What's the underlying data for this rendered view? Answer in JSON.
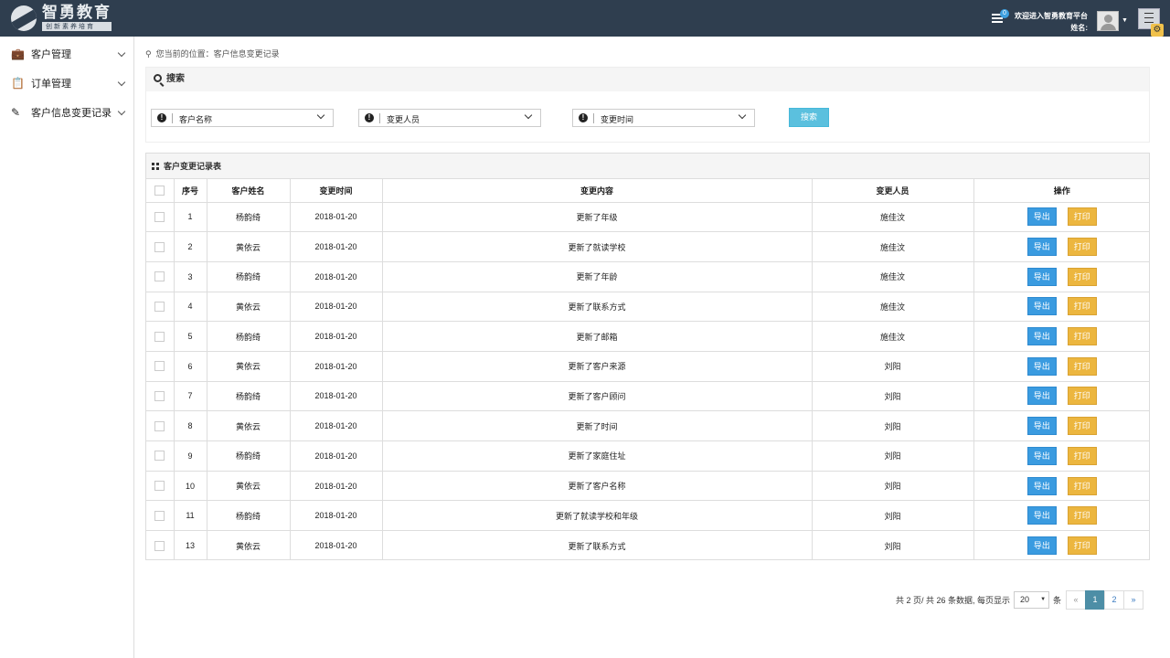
{
  "header": {
    "logo_title": "智勇教育",
    "logo_subtitle": "创新素养培育",
    "message_count": "0",
    "welcome": "欢迎进入智勇教育平台",
    "user_label": "姓名:"
  },
  "sidebar": {
    "items": [
      {
        "label": "客户管理",
        "icon": "briefcase-icon"
      },
      {
        "label": "订单管理",
        "icon": "clipboard-icon"
      },
      {
        "label": "客户信息变更记录",
        "icon": "edit-icon"
      }
    ]
  },
  "breadcrumb": "您当前的位置：客户信息变更记录",
  "search": {
    "title": "搜索",
    "fields": [
      "客户名称",
      "变更人员",
      "变更时间"
    ],
    "button": "搜索"
  },
  "table": {
    "title": "客户变更记录表",
    "columns": [
      "序号",
      "客户姓名",
      "变更时间",
      "变更内容",
      "变更人员",
      "操作"
    ],
    "export_label": "导出",
    "print_label": "打印",
    "rows": [
      {
        "no": "1",
        "name": "杨韵绮",
        "date": "2018-01-20",
        "content": "更新了年级",
        "operator": "施佳汶"
      },
      {
        "no": "2",
        "name": "黄依云",
        "date": "2018-01-20",
        "content": "更新了就读学校",
        "operator": "施佳汶"
      },
      {
        "no": "3",
        "name": "杨韵绮",
        "date": "2018-01-20",
        "content": "更新了年龄",
        "operator": "施佳汶"
      },
      {
        "no": "4",
        "name": "黄依云",
        "date": "2018-01-20",
        "content": "更新了联系方式",
        "operator": "施佳汶"
      },
      {
        "no": "5",
        "name": "杨韵绮",
        "date": "2018-01-20",
        "content": "更新了邮箱",
        "operator": "施佳汶"
      },
      {
        "no": "6",
        "name": "黄依云",
        "date": "2018-01-20",
        "content": "更新了客户来源",
        "operator": "刘阳"
      },
      {
        "no": "7",
        "name": "杨韵绮",
        "date": "2018-01-20",
        "content": "更新了客户顾问",
        "operator": "刘阳"
      },
      {
        "no": "8",
        "name": "黄依云",
        "date": "2018-01-20",
        "content": "更新了时间",
        "operator": "刘阳"
      },
      {
        "no": "9",
        "name": "杨韵绮",
        "date": "2018-01-20",
        "content": "更新了家庭住址",
        "operator": "刘阳"
      },
      {
        "no": "10",
        "name": "黄依云",
        "date": "2018-01-20",
        "content": "更新了客户名称",
        "operator": "刘阳"
      },
      {
        "no": "11",
        "name": "杨韵绮",
        "date": "2018-01-20",
        "content": "更新了就读学校和年级",
        "operator": "刘阳"
      },
      {
        "no": "13",
        "name": "黄依云",
        "date": "2018-01-20",
        "content": "更新了联系方式",
        "operator": "刘阳"
      }
    ]
  },
  "pagination": {
    "summary": "共 2 页/ 共 26 条数据, 每页显示",
    "page_size": "20",
    "unit": "条",
    "prev": "«",
    "pages": [
      "1",
      "2"
    ],
    "next": "»",
    "current_page": "1"
  }
}
